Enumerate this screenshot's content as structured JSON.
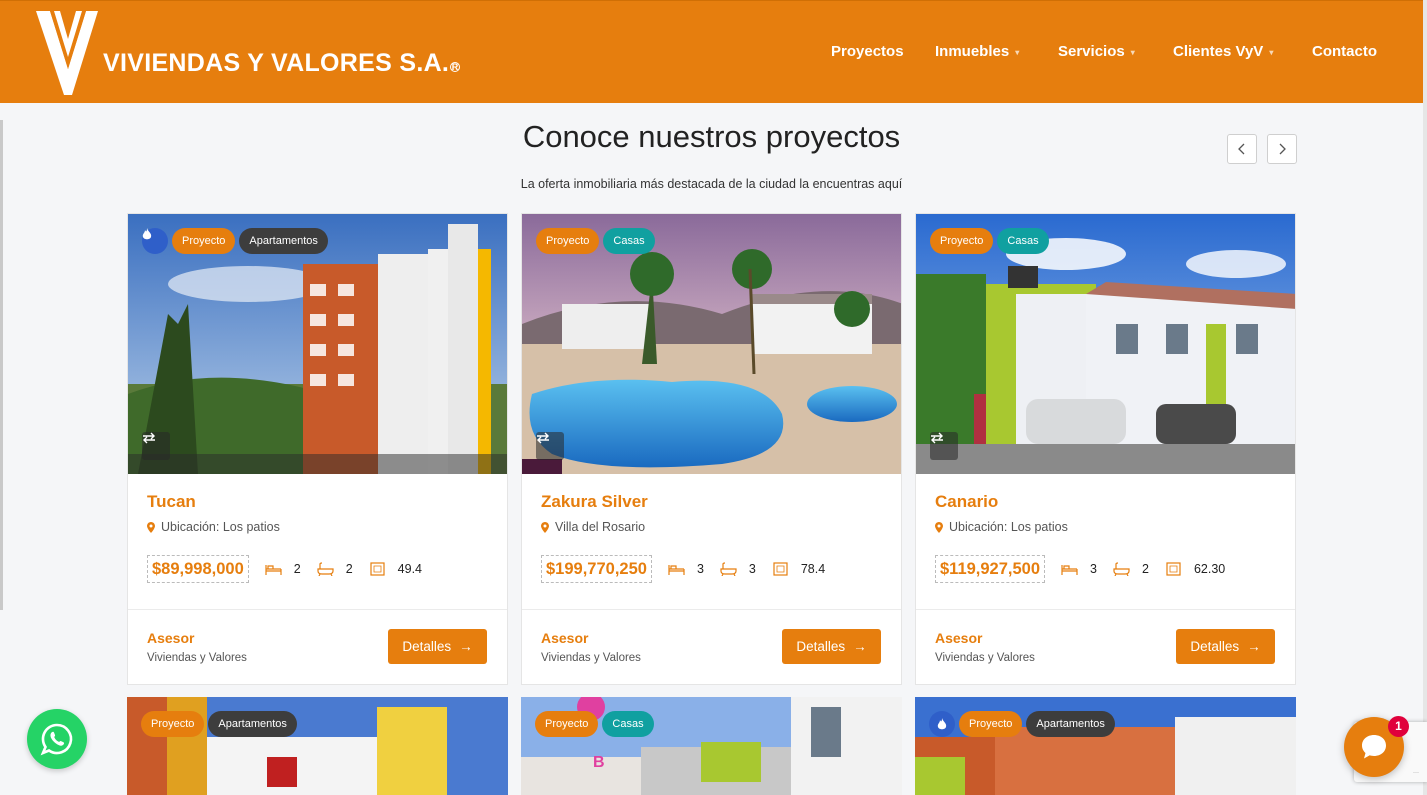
{
  "brand": {
    "name": "VIVIENDAS Y VALORES S.A.",
    "reg": "R"
  },
  "nav": [
    {
      "label": "Proyectos",
      "dropdown": false
    },
    {
      "label": "Inmuebles",
      "dropdown": true
    },
    {
      "label": "Servicios",
      "dropdown": true
    },
    {
      "label": "Clientes VyV",
      "dropdown": true
    },
    {
      "label": "Contacto",
      "dropdown": false
    }
  ],
  "section": {
    "title": "Conoce nuestros proyectos",
    "subtitle": "La oferta inmobiliaria más destacada de la ciudad la encuentras aquí"
  },
  "cards": [
    {
      "title": "Tucan",
      "location": "Ubicación: Los patios",
      "price": "$89,998,000",
      "beds": "2",
      "baths": "2",
      "area": "49.4",
      "tags": [
        "Proyecto",
        "Apartamentos"
      ],
      "hot": true,
      "asesor_label": "Asesor",
      "asesor_name": "Viviendas y Valores",
      "button": "Detalles"
    },
    {
      "title": "Zakura Silver",
      "location": "Villa del Rosario",
      "price": "$199,770,250",
      "beds": "3",
      "baths": "3",
      "area": "78.4",
      "tags": [
        "Proyecto",
        "Casas"
      ],
      "hot": false,
      "asesor_label": "Asesor",
      "asesor_name": "Viviendas y Valores",
      "button": "Detalles"
    },
    {
      "title": "Canario",
      "location": "Ubicación: Los patios",
      "price": "$119,927,500",
      "beds": "3",
      "baths": "2",
      "area": "62.30",
      "tags": [
        "Proyecto",
        "Casas"
      ],
      "hot": false,
      "asesor_label": "Asesor",
      "asesor_name": "Viviendas y Valores",
      "button": "Detalles"
    }
  ],
  "cards_row2": [
    {
      "tags": [
        "Proyecto",
        "Apartamentos"
      ],
      "hot": false
    },
    {
      "tags": [
        "Proyecto",
        "Casas"
      ],
      "hot": false
    },
    {
      "tags": [
        "Proyecto",
        "Apartamentos"
      ],
      "hot": true
    }
  ],
  "chat": {
    "badge": "1"
  },
  "colors": {
    "primary": "#e67e0e",
    "teal": "#10a0a0",
    "dark_tag": "#3d3d3d",
    "hot": "#2f5fc9",
    "whatsapp": "#25d366"
  }
}
